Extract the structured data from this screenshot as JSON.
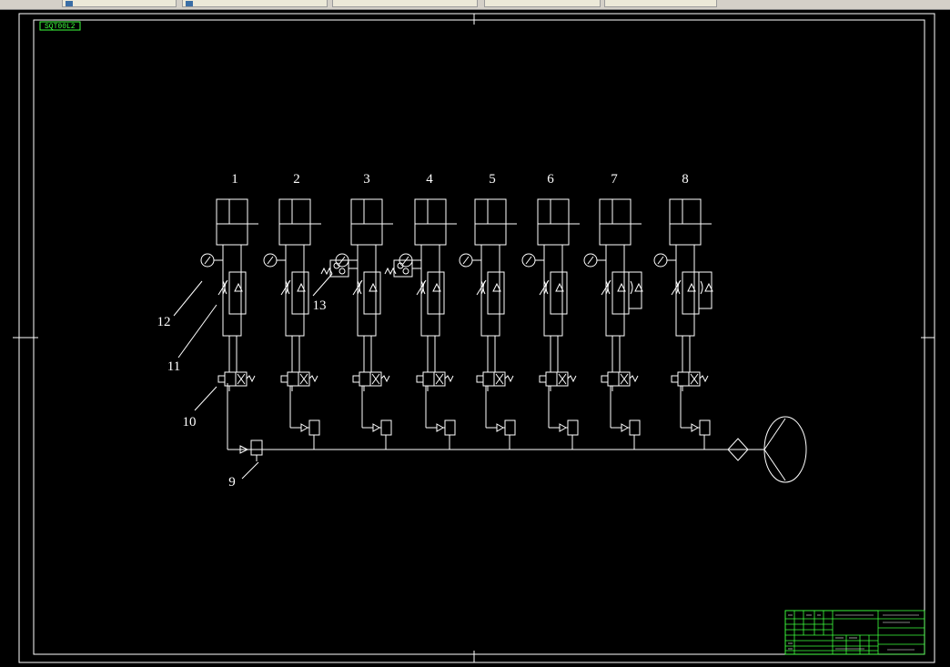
{
  "window": {
    "tabs": [
      {
        "label": "",
        "active": false
      },
      {
        "label": "",
        "active": false
      },
      {
        "label": "",
        "active": false
      },
      {
        "label": "",
        "active": false
      },
      {
        "label": "",
        "active": false
      }
    ]
  },
  "drawing": {
    "stamp": "SQT00L2",
    "background": "#000000",
    "line_color": "#ffffff",
    "accent_color": "#3cff3c",
    "channel_numbers": [
      "1",
      "2",
      "3",
      "4",
      "5",
      "6",
      "7",
      "8"
    ],
    "callouts": [
      "12",
      "11",
      "10",
      "9",
      "13"
    ]
  }
}
